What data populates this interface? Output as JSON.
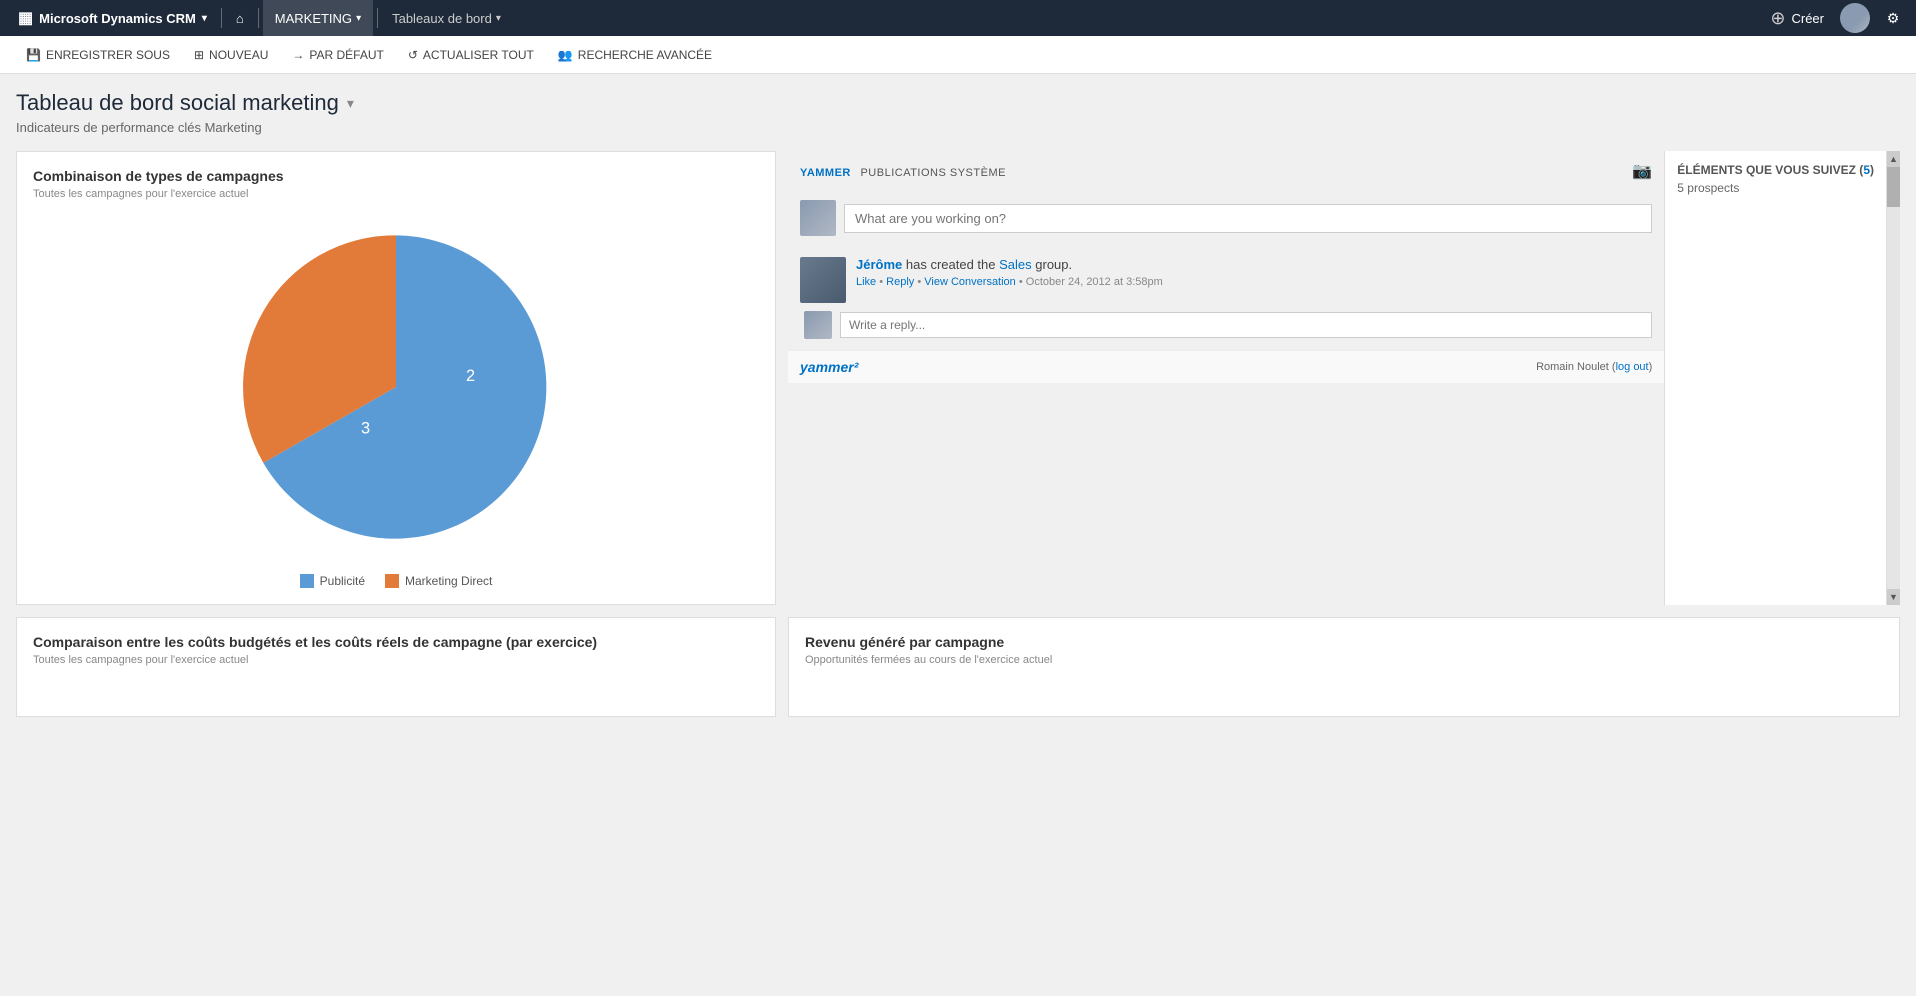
{
  "app": {
    "brand": "Microsoft Dynamics CRM",
    "brand_icon": "▦",
    "nav_chevron": "▾",
    "home_icon": "⌂",
    "nav_divider": "|"
  },
  "navbar": {
    "marketing_label": "MARKETING",
    "tableau_label": "Tableaux de bord",
    "create_label": "Créer",
    "settings_icon": "⚙",
    "plus_icon": "⊕"
  },
  "toolbar": {
    "save_label": "ENREGISTRER SOUS",
    "new_label": "NOUVEAU",
    "default_label": "PAR DÉFAUT",
    "refresh_label": "ACTUALISER TOUT",
    "search_label": "RECHERCHE AVANCÉE",
    "save_icon": "💾",
    "new_icon": "⊞",
    "default_icon": "→",
    "refresh_icon": "↺",
    "search_icon": "👥"
  },
  "page": {
    "title": "Tableau de bord social marketing",
    "title_chevron": "▾",
    "subtitle": "Indicateurs de performance clés Marketing"
  },
  "pie_chart": {
    "title": "Combinaison de types de campagnes",
    "subtitle": "Toutes les campagnes pour l'exercice actuel",
    "segment_blue_label": "Publicité",
    "segment_orange_label": "Marketing Direct",
    "segment_blue_value": "3",
    "segment_orange_value": "2",
    "segment_blue_color": "#5b9bd5",
    "segment_orange_color": "#e27b3a",
    "legend_color_blue": "#5b9bd5",
    "legend_color_orange": "#e27b3a"
  },
  "yammer": {
    "header_brand": "YAMMER",
    "header_subtitle": "PUBLICATIONS SYSTÈME",
    "compose_placeholder": "What are you working on?",
    "post_author": "Jérôme",
    "post_text": "has created the",
    "post_link": "Sales",
    "post_suffix": "group.",
    "post_like": "Like",
    "post_reply": "Reply",
    "post_view": "View Conversation",
    "post_date": "October 24, 2012 at 3:58pm",
    "reply_placeholder": "Write a reply...",
    "footer_logo": "yammer²",
    "footer_user": "Romain Noulet",
    "footer_logout": "log out",
    "camera_icon": "📷"
  },
  "sidebar": {
    "title": "ÉLÉMENTS QUE VOUS SUIVEZ (",
    "count": "5",
    "title_suffix": ")",
    "prospects_label": "5 prospects"
  },
  "bottom_left": {
    "title": "Comparaison entre les coûts budgétés et les coûts réels de campagne (par exercice)",
    "subtitle": "Toutes les campagnes pour l'exercice actuel"
  },
  "bottom_right": {
    "title": "Revenu généré par campagne",
    "subtitle": "Opportunités fermées au cours de l'exercice actuel"
  }
}
